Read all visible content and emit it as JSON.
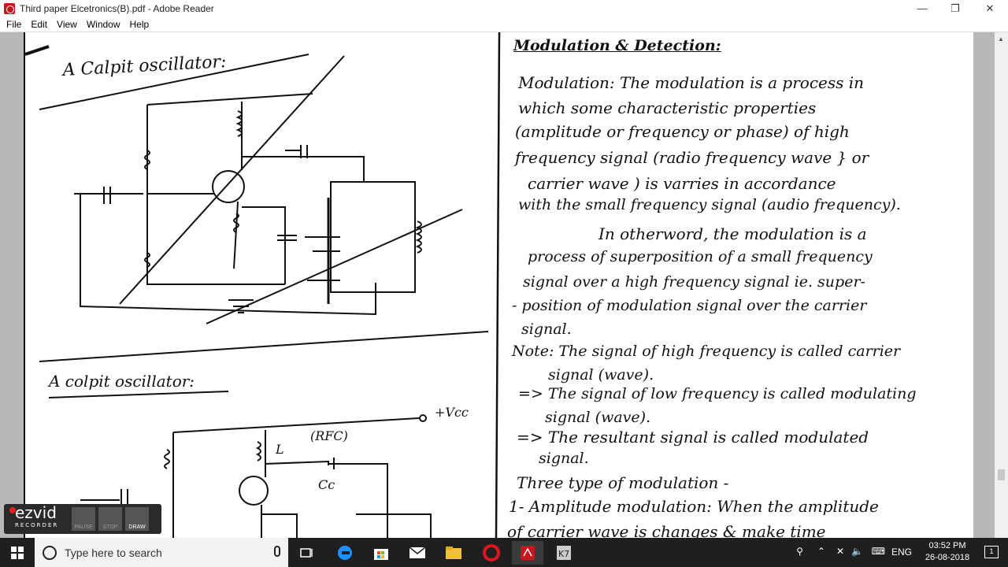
{
  "window": {
    "title": "Third paper Elcetronics(B).pdf - Adobe Reader",
    "minimize": "—",
    "restore": "❐",
    "close": "✕"
  },
  "menu": [
    "File",
    "Edit",
    "View",
    "Window",
    "Help"
  ],
  "notes_left": {
    "heading1": "A Calpit oscillator:",
    "heading2": "A colpit oscillator:",
    "vcc": "+Vcc",
    "rfc": "(RFC)",
    "inductor": "L",
    "cap": "Cc"
  },
  "notes_right": {
    "title": "Modulation & Detection:",
    "lines": [
      "Modulation: The modulation is a process in",
      "which some characteristic properties",
      "(amplitude or frequency or phase) of high",
      "frequency signal (radio frequency wave } or",
      "carrier wave ) is varries in accordance",
      "with the small frequency signal (audio frequency).",
      "In otherword, the modulation is a",
      "process of superposition of a small frequency",
      "signal over a high frequency signal ie. super-",
      "- position of modulation signal over the carrier",
      "signal.",
      "Note: The signal of high frequency is called carrier",
      "signal (wave).",
      "=> The signal of low frequency is called modulating",
      "signal (wave).",
      "=> The resultant signal is called modulated",
      "signal.",
      "Three type of modulation -",
      "1- Amplitude modulation: When the amplitude",
      "of carrier wave is changes & make time"
    ]
  },
  "recorder": {
    "brand": "ezvid",
    "sub": "RECORDER",
    "pause": "PAUSE",
    "stop": "STOP",
    "draw": "DRAW"
  },
  "taskbar": {
    "search_placeholder": "Type here to search",
    "language": "ENG",
    "time": "03:52 PM",
    "date": "26-08-2018",
    "notification_count": "1"
  }
}
